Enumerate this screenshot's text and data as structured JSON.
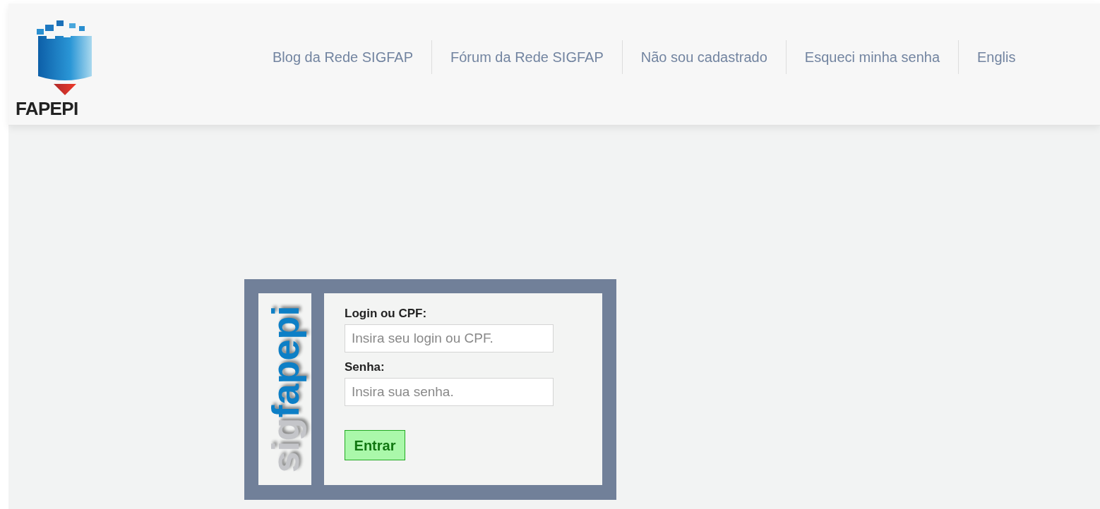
{
  "header": {
    "logo_text": "FAPEPI",
    "nav": [
      "Blog da Rede SIGFAP",
      "Fórum da Rede SIGFAP",
      "Não sou cadastrado",
      "Esqueci minha senha",
      "Englis"
    ]
  },
  "login": {
    "side_logo": [
      {
        "text": "sig",
        "color": "#c4c5c9"
      },
      {
        "text": "fapepi",
        "color": "#0d7fc6"
      }
    ],
    "fields": [
      {
        "label": "Login ou CPF:",
        "placeholder": "Insira seu login ou CPF."
      },
      {
        "label": "Senha:",
        "placeholder": "Insira sua senha."
      }
    ],
    "button": "Entrar"
  }
}
